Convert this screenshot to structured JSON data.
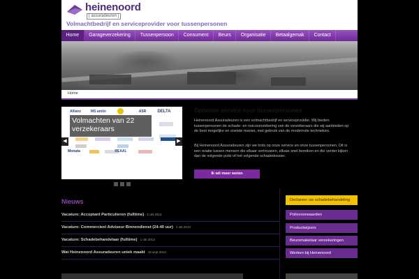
{
  "header": {
    "brand": "heinenoord",
    "brand_sub": "[ assuradeuren ]",
    "tagline": "Volmachtbedrijf en serviceprovider voor tussenpersonen"
  },
  "nav": {
    "items": [
      {
        "label": "Home"
      },
      {
        "label": "Garageverzekering"
      },
      {
        "label": "Tussenpersoon"
      },
      {
        "label": "Consument"
      },
      {
        "label": "Beurs"
      },
      {
        "label": "Organisatie"
      },
      {
        "label": "Betaalgemak"
      },
      {
        "label": "Contact"
      }
    ]
  },
  "breadcrumb": "Home",
  "slider": {
    "caption": "Volmachten van 22 verzekeraars",
    "logos": [
      "Allianz",
      "MS amlin",
      "",
      "ASR",
      "DELTA",
      "",
      "",
      "",
      "",
      "",
      "",
      "",
      "",
      "",
      "",
      "Monuta",
      "",
      "",
      "REAAL",
      ""
    ],
    "prev_icon": "chevron-left",
    "next_icon": "chevron-right",
    "dots": 3
  },
  "intro": {
    "title": "Optimale service voor tussenpersonen",
    "p1": "Heinenoord Assuradeuren is een volmachtbedrijf en serviceprovider. Wij bieden tussenpersonen de schade- en risicoverzekering van de verzekeraars die wij aanbieden op de best mogelijke en snelste manier, met gebruik van de modernste technieken.",
    "p2": "Bij Heinenoord Assuradeuren zijn we trots op onze service en onze tussenpersonen. Dit is een relatie tussen mensen die elkaar vertrouwen, elkaar snel bereiken en die verder kijken dan de volgende polis of het volgende schadedossier.",
    "button": "Ik wil meer weten"
  },
  "news": {
    "title": "Nieuws",
    "items": [
      {
        "title": "Vacature: Acceptant Particulieren (fulltime)",
        "date": "2 okt 2013"
      },
      {
        "title": "Vacature: Commercieel Adviseur Binnendienst (24-40 uur)",
        "date": "1 okt 2013"
      },
      {
        "title": "Vacature: Schadebehandelaar (fulltime)",
        "date": "1 okt 2013"
      },
      {
        "title": "Wat Heinenoord Assuradeuren uniek maakt",
        "date": "18 sept 2013"
      }
    ]
  },
  "sidebar": {
    "items": [
      {
        "label": "Declareer uw schadebehandeling",
        "active": true
      },
      {
        "label": "Polisvoorwaarden",
        "active": false
      },
      {
        "label": "Productwijzers",
        "active": false
      },
      {
        "label": "Beursmakelaar verzekeringen",
        "active": false
      },
      {
        "label": "Werken bij Heinenoord",
        "active": false
      }
    ]
  },
  "colors": {
    "brand_purple": "#6b2c92",
    "accent_yellow": "#f1c200",
    "tagline_purple": "#7b6ab8"
  }
}
